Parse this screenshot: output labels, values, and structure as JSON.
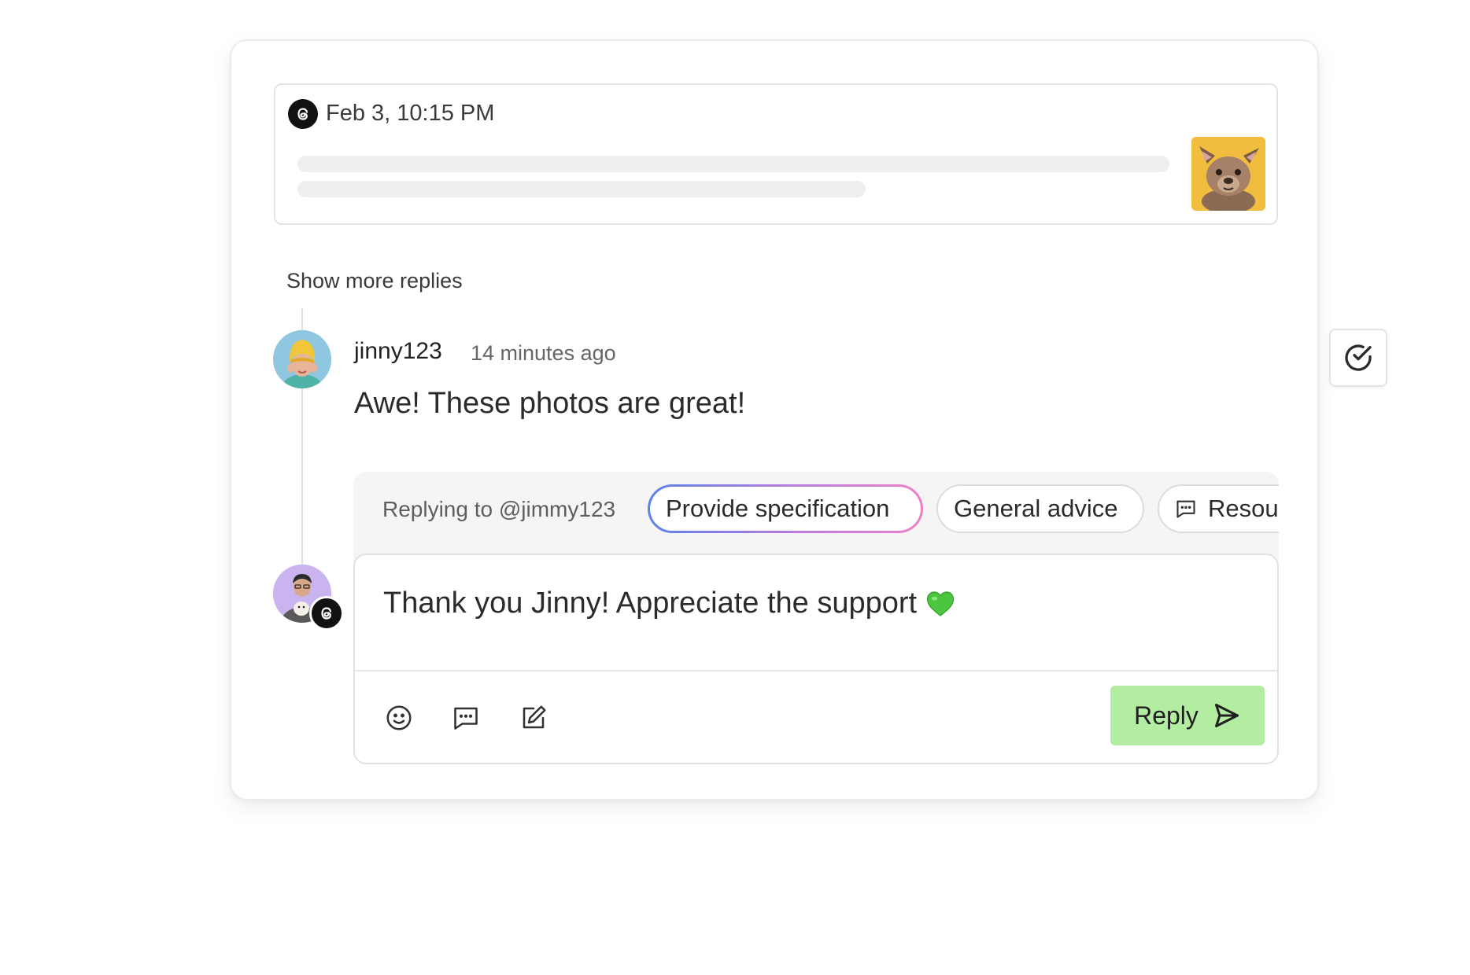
{
  "post": {
    "date": "Feb 3, 10:15 PM",
    "platform_icon": "threads-icon",
    "thumbnail_icon": "dog-photo"
  },
  "thread": {
    "show_more_label": "Show more replies"
  },
  "comment": {
    "username": "jinny123",
    "time_ago": "14 minutes ago",
    "text": "Awe! These photos are great!"
  },
  "composer": {
    "replying_to": "Replying to @jimmy123",
    "chips": [
      {
        "label": "Provide specification",
        "selected": true
      },
      {
        "label": "General advice",
        "selected": false
      },
      {
        "label": "Resources",
        "icon": "message-icon",
        "selected": false
      }
    ],
    "input_value": "Thank you Jinny! Appreciate the support",
    "input_emoji": "💚",
    "tools": [
      "emoji-icon",
      "message-icon",
      "edit-icon"
    ],
    "reply_label": "Reply",
    "reply_color": "#b3eda1"
  },
  "side_action": {
    "icon": "check-circle-icon"
  }
}
